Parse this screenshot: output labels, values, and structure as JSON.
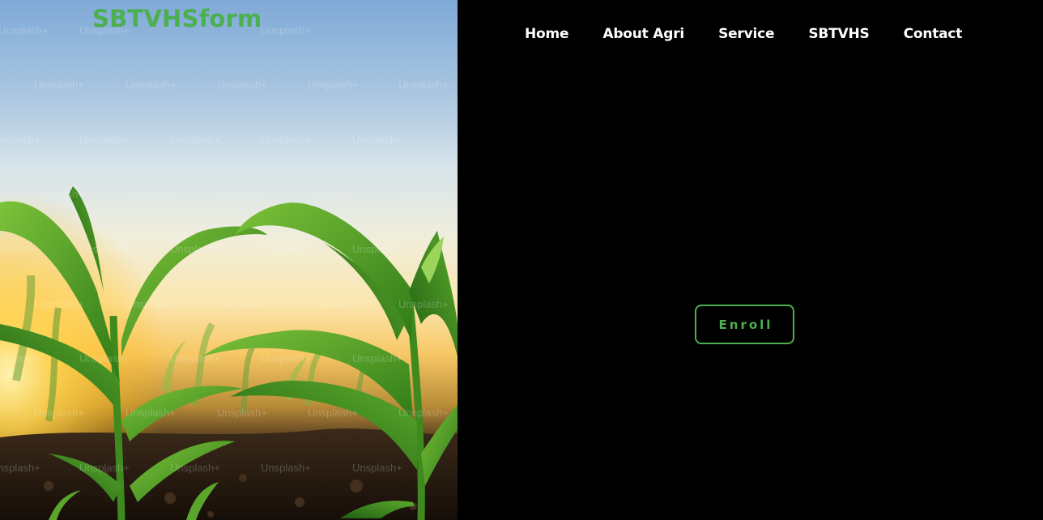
{
  "brand": {
    "name": "SBTVHSform",
    "color": "#4caf50"
  },
  "nav": {
    "items": [
      {
        "label": "Home"
      },
      {
        "label": "About Agri"
      },
      {
        "label": "Service"
      },
      {
        "label": "SBTVHS"
      },
      {
        "label": "Contact"
      }
    ]
  },
  "hero": {
    "watermark": "Unsplash+"
  },
  "cta": {
    "enroll_label": "Enroll",
    "accent": "#4caf50"
  }
}
